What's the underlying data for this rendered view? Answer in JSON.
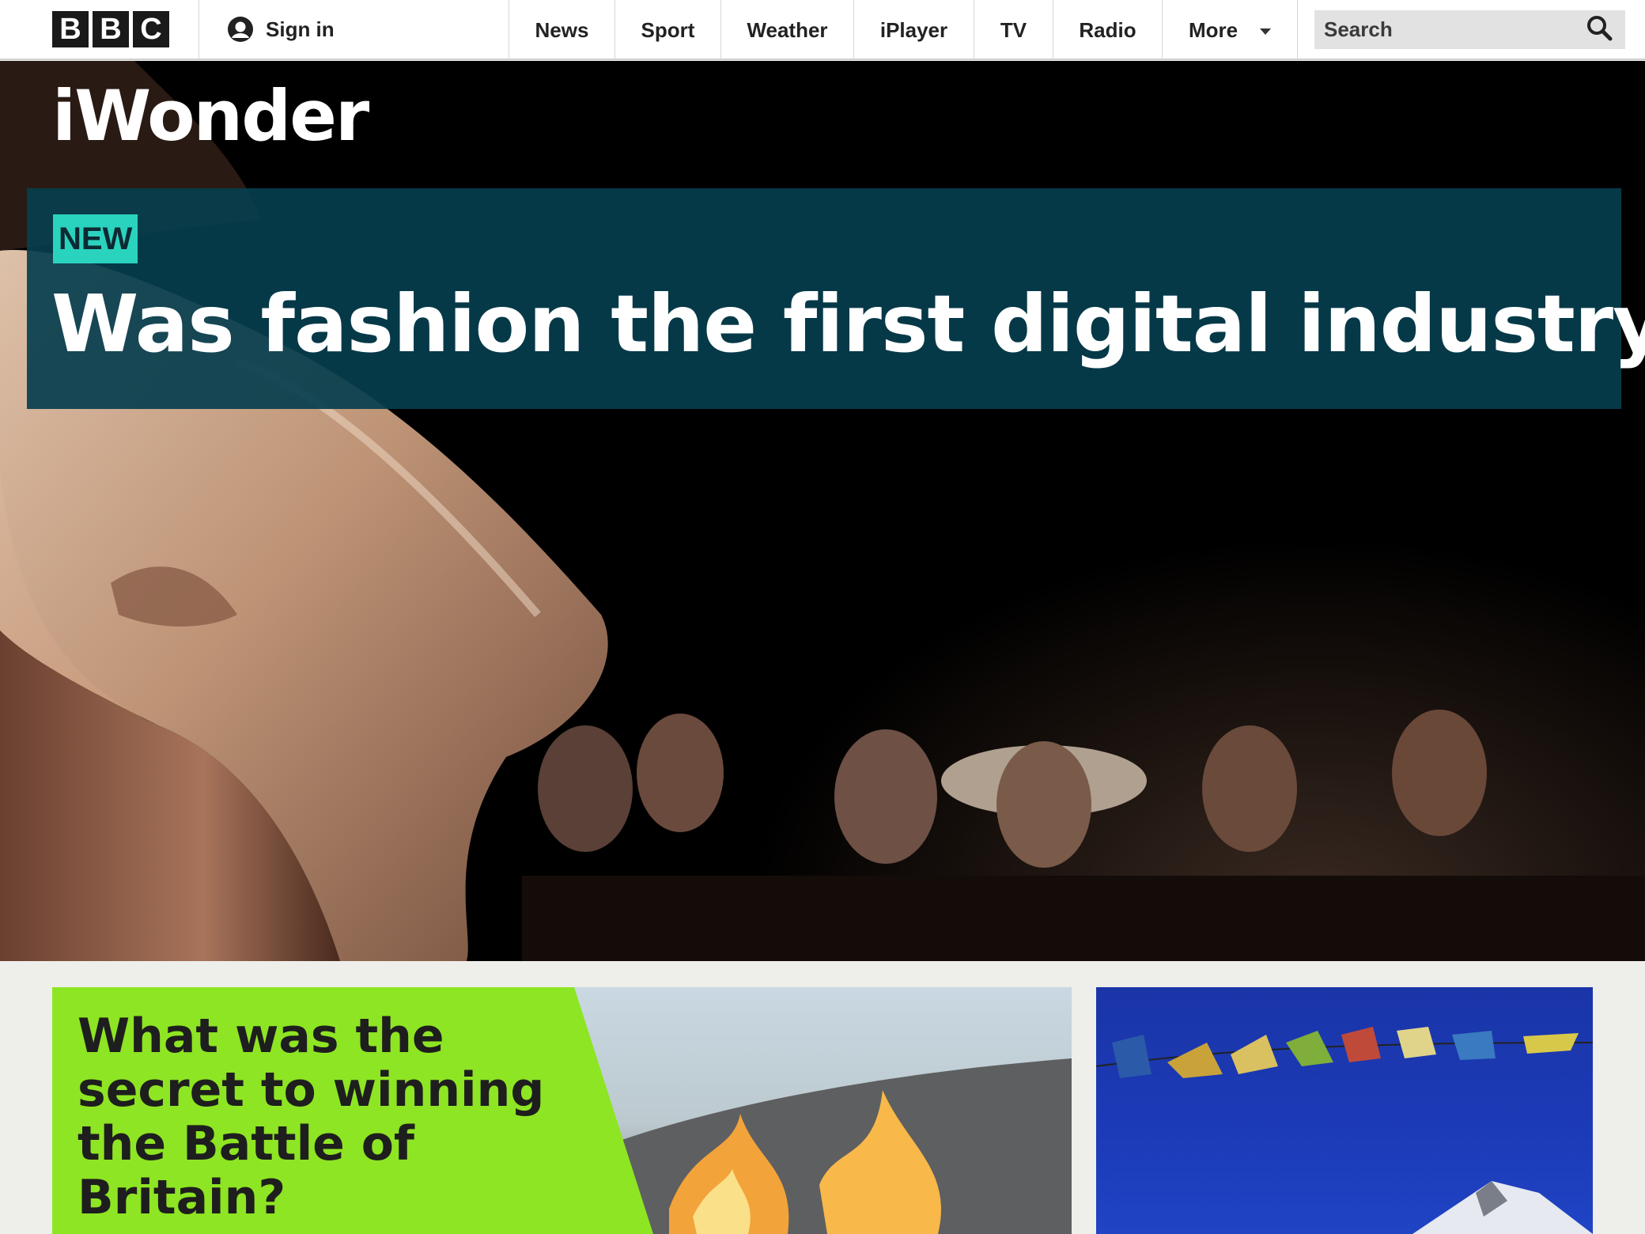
{
  "header": {
    "logo_letters": [
      "B",
      "B",
      "C"
    ],
    "sign_in_label": "Sign in",
    "nav_items": [
      {
        "label": "News"
      },
      {
        "label": "Sport"
      },
      {
        "label": "Weather"
      },
      {
        "label": "iPlayer"
      },
      {
        "label": "TV"
      },
      {
        "label": "Radio"
      }
    ],
    "more_label": "More",
    "search_placeholder": "Search",
    "icons": {
      "sign_in": "user-icon",
      "more": "chevron-down-icon",
      "search": "search-icon"
    }
  },
  "hero": {
    "brand": "iWonder",
    "badge": "NEW",
    "headline": "Was fashion the first digital industry?",
    "colors": {
      "panel": "#063e4e",
      "badge": "#2ad3be"
    }
  },
  "cards": [
    {
      "title": "What was the secret to winning the Battle of Britain?",
      "accent": "#8ee523"
    }
  ]
}
